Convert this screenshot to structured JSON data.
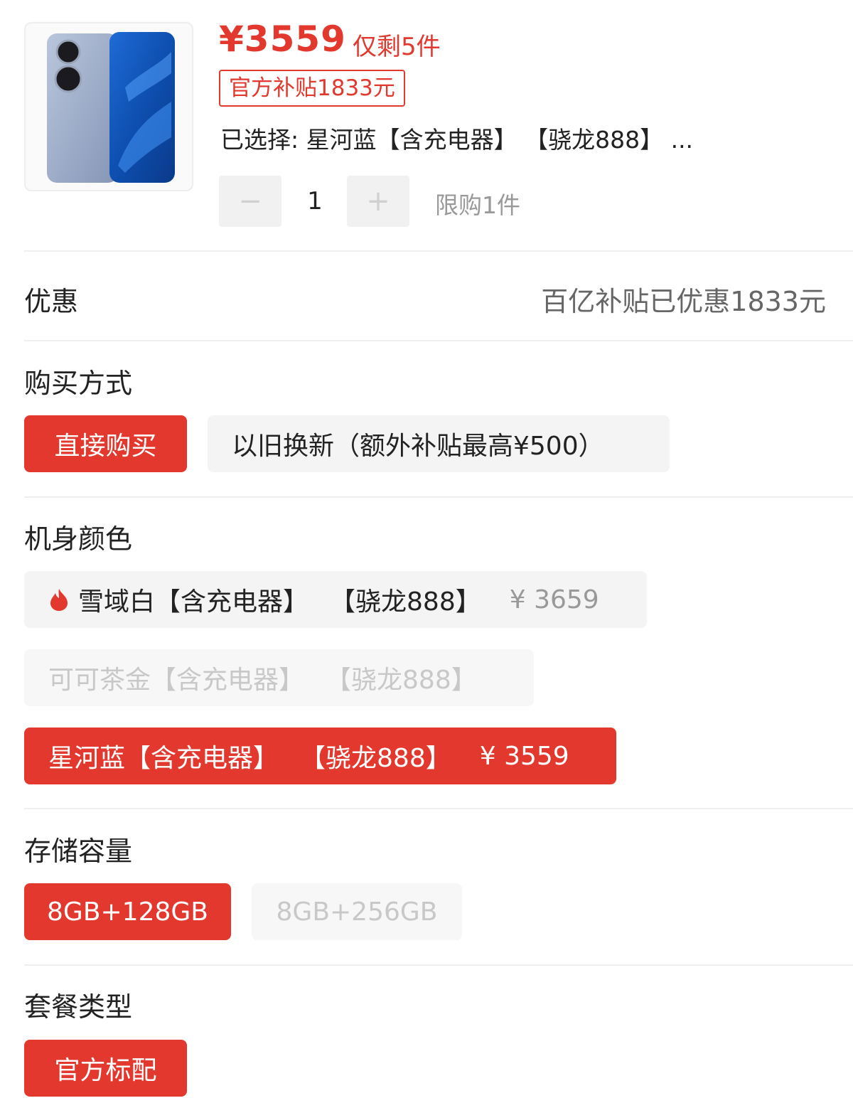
{
  "product": {
    "price": "¥3559",
    "stock_note": "仅剩5件",
    "subsidy_tag": "官方补贴1833元",
    "selected_text": "已选择: 星河蓝【含充电器】 【骁龙888】 ...",
    "quantity": "1",
    "minus_symbol": "−",
    "plus_symbol": "+",
    "limit_text": "限购1件"
  },
  "promo": {
    "label": "优惠",
    "value": "百亿补贴已优惠1833元"
  },
  "purchase": {
    "label": "购买方式",
    "options": [
      {
        "label": "直接购买",
        "state": "selected"
      },
      {
        "label": "以旧换新（额外补贴最高¥500）",
        "state": "normal"
      }
    ]
  },
  "color": {
    "label": "机身颜色",
    "options": [
      {
        "name": "雪域白【含充电器】",
        "chip": "【骁龙888】",
        "price": "¥ 3659",
        "state": "normal",
        "hot": true
      },
      {
        "name": "可可茶金【含充电器】",
        "chip": "【骁龙888】",
        "price": "",
        "state": "disabled"
      },
      {
        "name": "星河蓝【含充电器】",
        "chip": "【骁龙888】",
        "price": "¥ 3559",
        "state": "selected"
      }
    ]
  },
  "storage": {
    "label": "存储容量",
    "options": [
      {
        "label": "8GB+128GB",
        "state": "selected"
      },
      {
        "label": "8GB+256GB",
        "state": "disabled"
      }
    ]
  },
  "package": {
    "label": "套餐类型",
    "options": [
      {
        "label": "官方标配",
        "state": "selected"
      }
    ]
  },
  "colors": {
    "accent": "#e2382e",
    "option_bg": "#f4f4f4",
    "disabled_text": "#c8c8c8"
  },
  "icons": [
    "phone-product-image",
    "minus-icon",
    "plus-icon",
    "flame-icon"
  ]
}
